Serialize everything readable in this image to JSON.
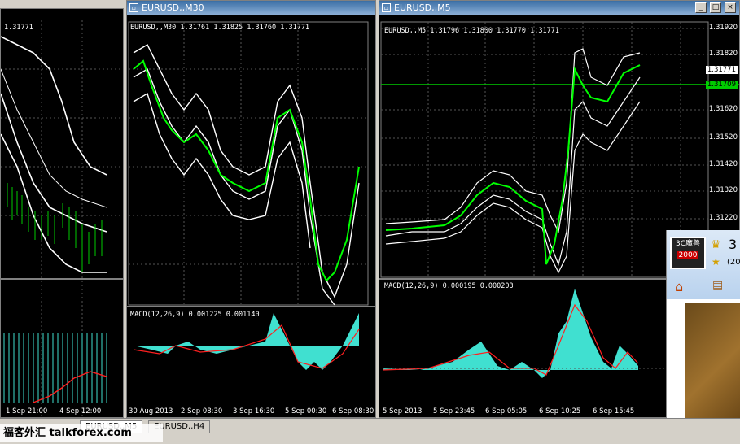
{
  "windows": [
    {
      "id": "left",
      "title": "",
      "price_label": "1.31771",
      "x_labels": [
        "1 Sep 21:00",
        "4 Sep 12:00"
      ]
    },
    {
      "id": "mid",
      "title": "EURUSD,,M30",
      "header": "EURUSD,,M30  1.31761 1.31825 1.31760 1.31771",
      "macd_label": "MACD(12,26,9) 0.001225 0.001140",
      "x_labels": [
        "30 Aug 2013",
        "2 Sep 08:30",
        "3 Sep 16:30",
        "5 Sep 00:30",
        "6 Sep 08:30"
      ]
    },
    {
      "id": "right",
      "title": "EURUSD,,M5",
      "header": "EURUSD,,M5  1.31796 1.31800 1.31770 1.31771",
      "macd_label": "MACD(12,26,9) 0.000195 0.000203",
      "x_labels": [
        "5 Sep 2013",
        "5 Sep 23:45",
        "6 Sep 05:05",
        "6 Sep 10:25",
        "6 Sep 15:45"
      ],
      "y_labels": [
        "1.31920",
        "1.31820",
        "1.31771",
        "1.31709",
        "1.31620",
        "1.31520",
        "1.31420",
        "1.31320",
        "1.31220"
      ]
    }
  ],
  "tabs": [
    "EURUSD,,M5",
    "EURUSD,,H4"
  ],
  "watermark": "福客外汇 talkforex.com",
  "popup": {
    "badge": "3C魔兽",
    "year": "2000",
    "num": "3",
    "paren": "(20"
  },
  "colors": {
    "bg": "#000000",
    "candle": "#00ff00",
    "macd": "#40e0d0",
    "signal": "#ff2020",
    "bands": "#ffffff"
  }
}
